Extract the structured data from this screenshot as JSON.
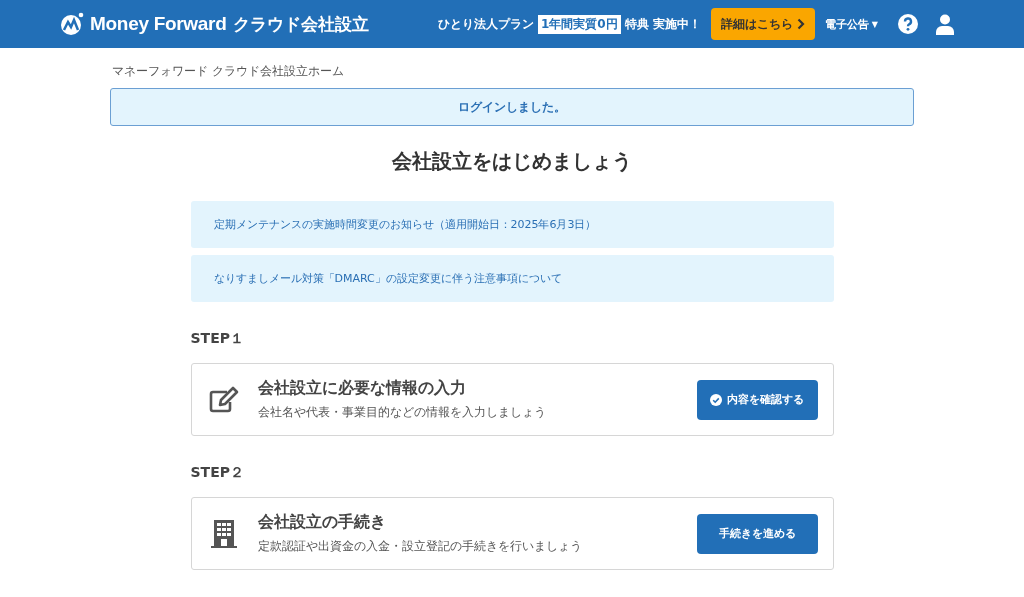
{
  "header": {
    "logo_brand": "Money Forward",
    "logo_product": "クラウド会社設立",
    "promo": {
      "lead": "ひとり法人プラン",
      "highlight": "1年間実質0円",
      "tail": "特典 実施中！"
    },
    "promo_button": "詳細はこちら",
    "menu": {
      "label": "電子公告",
      "caret": "▼"
    }
  },
  "breadcrumb": "マネーフォワード クラウド会社設立ホーム",
  "alert": "ログインしました。",
  "title": "会社設立をはじめましょう",
  "notices": [
    "定期メンテナンスの実施時間変更のお知らせ（適用開始日：2025年6月3日）",
    "なりすましメール対策「DMARC」の設定変更に伴う注意事項について"
  ],
  "steps": [
    {
      "label": "STEP１",
      "kind": "edit",
      "title": "会社設立に必要な情報の入力",
      "description": "会社名や代表・事業目的などの情報を入力しましょう",
      "button": "内容を確認する",
      "done": true
    },
    {
      "label": "STEP２",
      "kind": "building",
      "title": "会社設立の手続き",
      "description": "定款認証や出資金の入金・設立登記の手続きを行いましょう",
      "button": "手続きを進める",
      "done": false
    }
  ]
}
